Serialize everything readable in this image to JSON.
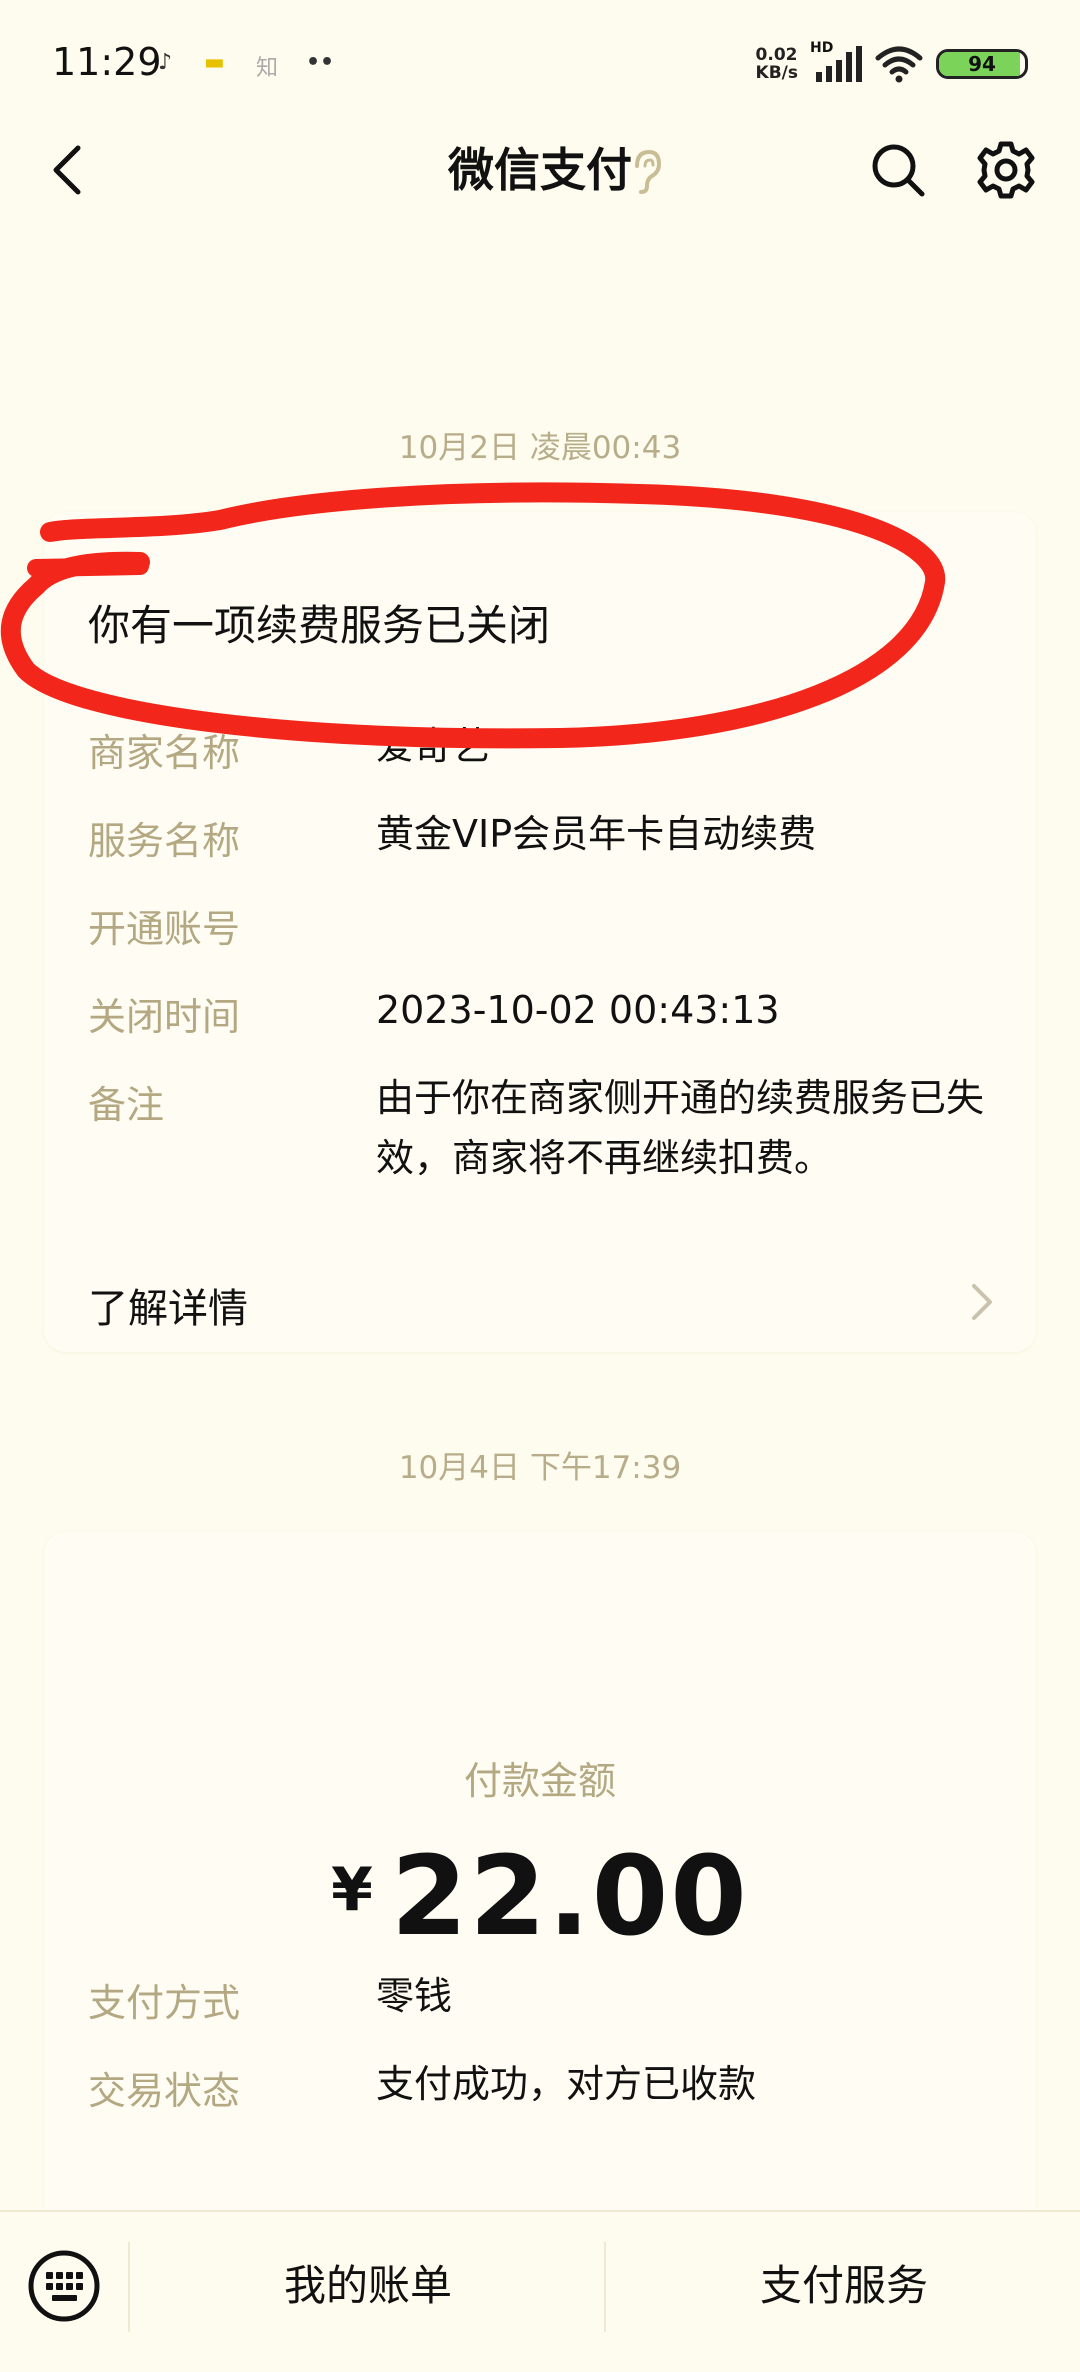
{
  "status_bar": {
    "time": "11:29",
    "app_icons": [
      "♪",
      "▬",
      "知",
      "••"
    ],
    "net_speed_value": "0.02",
    "net_speed_unit": "KB/s",
    "hd_label": "HD",
    "battery": "94",
    "battery_level": 0.94
  },
  "nav": {
    "title": "微信支付"
  },
  "notice1": {
    "timestamp": "10月2日 凌晨00:43",
    "title": "你有一项续费服务已关闭",
    "rows": [
      {
        "label": "商家名称",
        "value": "爱奇艺"
      },
      {
        "label": "服务名称",
        "value": "黄金VIP会员年卡自动续费"
      },
      {
        "label": "开通账号",
        "value": ""
      },
      {
        "label": "关闭时间",
        "value": "2023-10-02 00:43:13"
      },
      {
        "label": "备注",
        "value": "由于你在商家侧开通的续费服务已失效，商家将不再继续扣费。"
      }
    ],
    "detail_label": "了解详情"
  },
  "notice2": {
    "timestamp": "10月4日 下午17:39",
    "amount_label": "付款金额",
    "currency_symbol": "¥",
    "amount": "22.00",
    "rows": [
      {
        "label": "支付方式",
        "value": "零钱"
      },
      {
        "label": "交易状态",
        "value": "支付成功，对方已收款"
      }
    ]
  },
  "bottom_bar": {
    "items": [
      "我的账单",
      "支付服务"
    ]
  },
  "colors": {
    "background": "#fefcee",
    "label": "#b3a882",
    "annotation": "#f2261b",
    "battery_fill": "#7bd35a"
  }
}
